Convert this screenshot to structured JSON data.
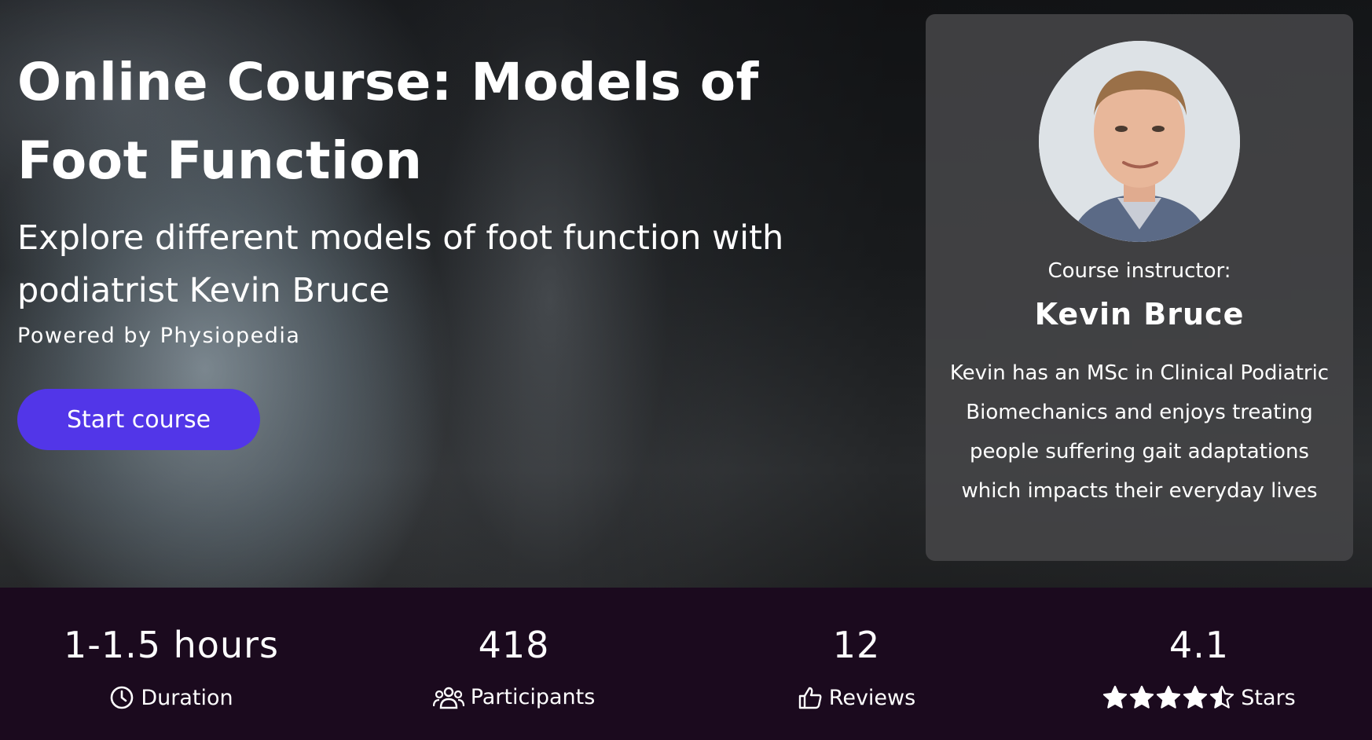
{
  "hero": {
    "title": "Online Course: Models of Foot Function",
    "subtitle": "Explore different models of foot function with podiatrist Kevin Bruce",
    "powered_by": "Powered by Physiopedia",
    "start_button_label": "Start course"
  },
  "instructor": {
    "label": "Course instructor:",
    "name": "Kevin Bruce",
    "bio": "Kevin has an MSc in Clinical Podiatric Biomechanics and enjoys treating people suffering gait adaptations which impacts their everyday lives"
  },
  "stats": {
    "duration": {
      "value": "1-1.5 hours",
      "label": "Duration",
      "icon": "clock-icon"
    },
    "participants": {
      "value": "418",
      "label": "Participants",
      "icon": "users-icon"
    },
    "reviews": {
      "value": "12",
      "label": "Reviews",
      "icon": "thumbs-up-icon"
    },
    "rating": {
      "value": "4.1",
      "label": "Stars",
      "icon": "star-icon",
      "stars_filled": 4.5,
      "stars_total": 5
    }
  },
  "colors": {
    "accent_button": "#5236e8",
    "stats_background": "#1b0a1e",
    "card_background": "#464648"
  }
}
